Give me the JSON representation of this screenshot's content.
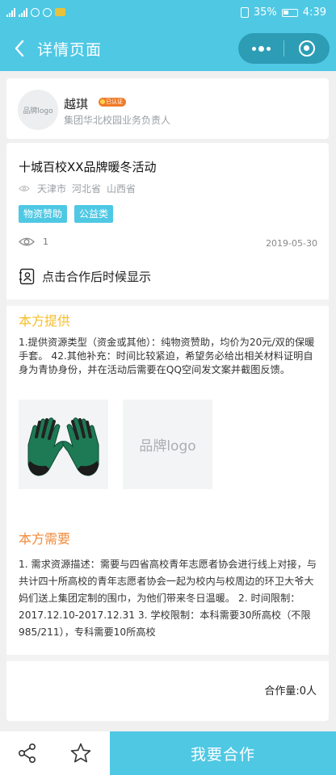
{
  "status_bar": {
    "battery": "35%",
    "time": "4:39"
  },
  "nav": {
    "title": "详情页面"
  },
  "profile": {
    "avatar_text": "品牌logo",
    "name": "越琪",
    "badge": "已认证",
    "role": "集团华北校园业务负责人"
  },
  "activity": {
    "title": "十城百校XX品牌暖冬活动",
    "locations": [
      "天津市",
      "河北省",
      "山西省"
    ],
    "tags": [
      "物资赞助",
      "公益类"
    ],
    "views": "1",
    "date": "2019-05-30",
    "contact_hint": "点击合作后时候显示"
  },
  "offer": {
    "title": "本方提供",
    "text": "1.提供资源类型（资金或其他）：纯物资赞助，均价为20元/双的保暖手套。 42.其他补充：时间比较紧迫，希望务必给出相关材料证明自身为青协身份，并在活动后需要在QQ空间发文案并截图反馈。",
    "image2_text": "品牌logo"
  },
  "need": {
    "title": "本方需要",
    "text": "1. 需求资源描述：需要与四省高校青年志愿者协会进行线上对接，与共计四十所高校的青年志愿者协会一起为校内与校周边的环卫大爷大妈们送上集团定制的围巾，为他们带来冬日温暖。 2. 时间限制：2017.12.10-2017.12.31 3. 学校限制：本科需要30所高校（不限985/211），专科需要10所高校"
  },
  "cooperation": {
    "count_label": "合作量:0人"
  },
  "bottom": {
    "cta": "我要合作"
  },
  "colors": {
    "primary": "#4fc8e4",
    "capsule": "#2d9db6",
    "offer_title": "#f5be2c",
    "need_title": "#f28a3a",
    "badge": "#f07b2a"
  }
}
